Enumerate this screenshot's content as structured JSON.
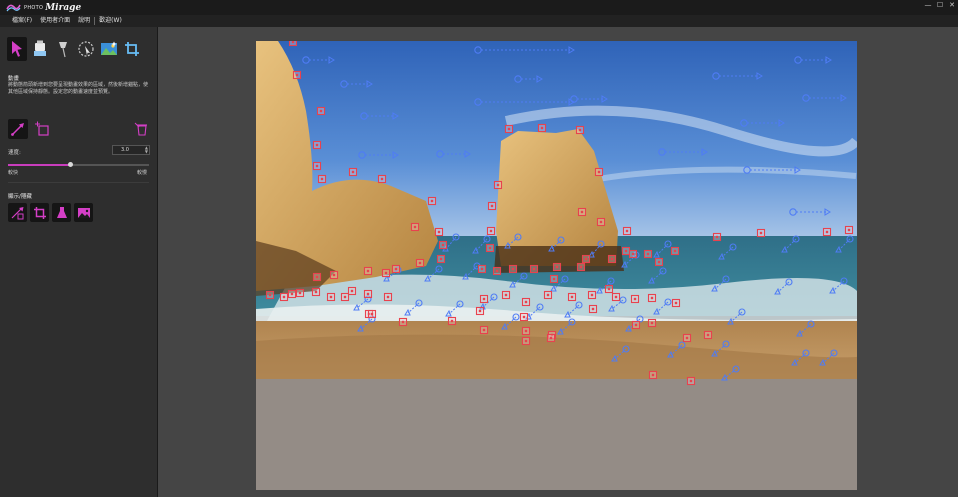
{
  "window": {
    "logo_small": "PHOTO",
    "logo_big": "Mirage",
    "controls": {
      "minimize": "—",
      "maximize": "☐",
      "close": "✕"
    }
  },
  "menu": {
    "items": [
      "檔案(F)",
      "使用者介面",
      "說明",
      "歡迎(W)"
    ]
  },
  "panel": {
    "section_title": "動畫",
    "description": "將動態箭頭新增到您要呈現動畫效果的區域，然後新增錨點，使其他區域保持靜態。設定您的動畫速度並預覽。",
    "speed_label": "速度:",
    "speed_value": "3.0",
    "speed_level": 0.44,
    "slider_min_label": "較快",
    "slider_max_label": "較慢",
    "overlay_title": "顯示/隱藏"
  },
  "icons": {
    "tools": [
      "select-arrow-icon",
      "eraser-icon",
      "anchor-point-icon",
      "selection-lasso-icon",
      "image-adjust-icon",
      "crop-icon"
    ],
    "modes": [
      "motion-arrow-tool-icon",
      "anchor-tool-icon",
      "clear-all-icon"
    ],
    "overlays": [
      "show-arrows-icon",
      "show-crop-icon",
      "show-mask-icon",
      "show-image-icon"
    ]
  },
  "colors": {
    "accent": "#c93dbd",
    "arrow_marker": "#4f7cf5",
    "anchor_marker": "#e8424e",
    "panel_bg": "#2e2e2e",
    "canvas_bg": "#454545"
  }
}
